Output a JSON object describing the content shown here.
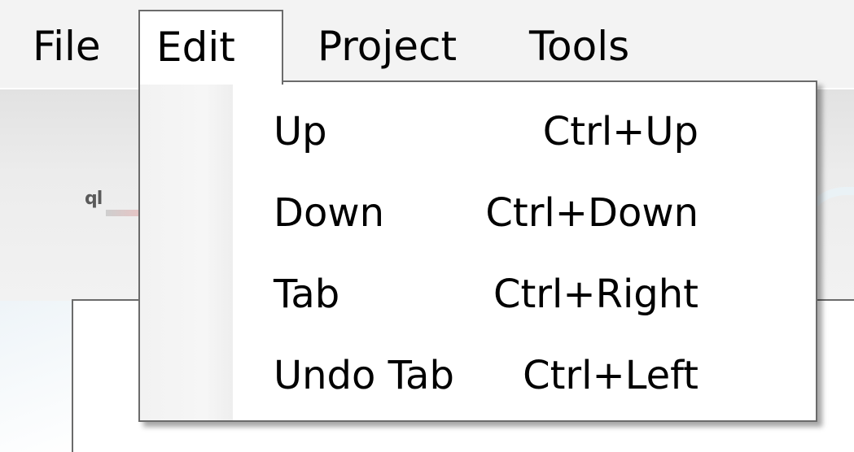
{
  "menubar": {
    "items": [
      {
        "label": "File"
      },
      {
        "label": "Edit"
      },
      {
        "label": "Project"
      },
      {
        "label": "Tools"
      }
    ]
  },
  "edit_menu": {
    "items": [
      {
        "label": "Up",
        "shortcut": "Ctrl+Up"
      },
      {
        "label": "Down",
        "shortcut": "Ctrl+Down"
      },
      {
        "label": "Tab",
        "shortcut": "Ctrl+Right"
      },
      {
        "label": "Undo Tab",
        "shortcut": "Ctrl+Left"
      }
    ]
  }
}
